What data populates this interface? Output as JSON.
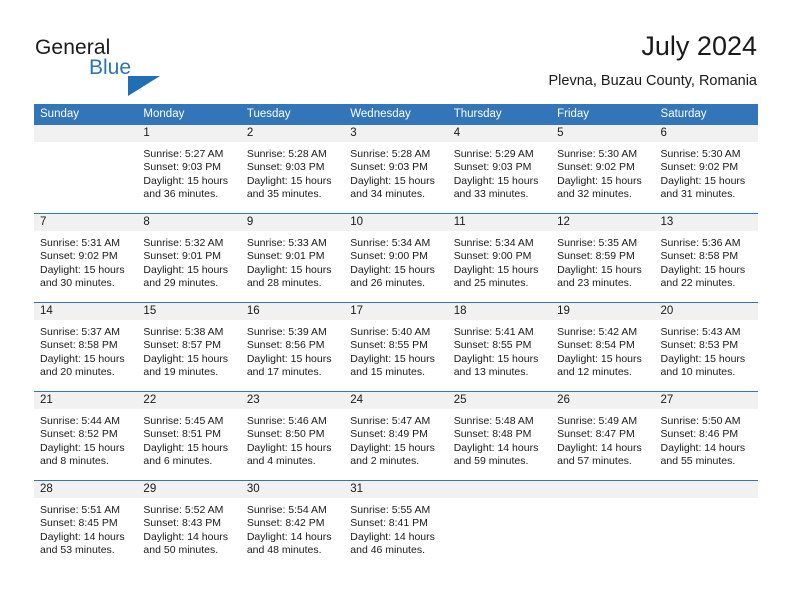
{
  "logo": {
    "word_one": "General",
    "word_two": "Blue",
    "triangle_icon": "triangle-icon",
    "brand_color": "#2a74b8"
  },
  "header": {
    "title": "July 2024",
    "subtitle": "Plevna, Buzau County, Romania"
  },
  "theme": {
    "header_blue": "#3275b8",
    "band_gray": "#f1f1f1",
    "text": "#1a1a1a"
  },
  "calendar": {
    "weekday_headers": [
      "Sunday",
      "Monday",
      "Tuesday",
      "Wednesday",
      "Thursday",
      "Friday",
      "Saturday"
    ],
    "weeks": [
      [
        {
          "day": "",
          "lines": []
        },
        {
          "day": "1",
          "lines": [
            "Sunrise: 5:27 AM",
            "Sunset: 9:03 PM",
            "Daylight: 15 hours",
            "and 36 minutes."
          ]
        },
        {
          "day": "2",
          "lines": [
            "Sunrise: 5:28 AM",
            "Sunset: 9:03 PM",
            "Daylight: 15 hours",
            "and 35 minutes."
          ]
        },
        {
          "day": "3",
          "lines": [
            "Sunrise: 5:28 AM",
            "Sunset: 9:03 PM",
            "Daylight: 15 hours",
            "and 34 minutes."
          ]
        },
        {
          "day": "4",
          "lines": [
            "Sunrise: 5:29 AM",
            "Sunset: 9:03 PM",
            "Daylight: 15 hours",
            "and 33 minutes."
          ]
        },
        {
          "day": "5",
          "lines": [
            "Sunrise: 5:30 AM",
            "Sunset: 9:02 PM",
            "Daylight: 15 hours",
            "and 32 minutes."
          ]
        },
        {
          "day": "6",
          "lines": [
            "Sunrise: 5:30 AM",
            "Sunset: 9:02 PM",
            "Daylight: 15 hours",
            "and 31 minutes."
          ]
        }
      ],
      [
        {
          "day": "7",
          "lines": [
            "Sunrise: 5:31 AM",
            "Sunset: 9:02 PM",
            "Daylight: 15 hours",
            "and 30 minutes."
          ]
        },
        {
          "day": "8",
          "lines": [
            "Sunrise: 5:32 AM",
            "Sunset: 9:01 PM",
            "Daylight: 15 hours",
            "and 29 minutes."
          ]
        },
        {
          "day": "9",
          "lines": [
            "Sunrise: 5:33 AM",
            "Sunset: 9:01 PM",
            "Daylight: 15 hours",
            "and 28 minutes."
          ]
        },
        {
          "day": "10",
          "lines": [
            "Sunrise: 5:34 AM",
            "Sunset: 9:00 PM",
            "Daylight: 15 hours",
            "and 26 minutes."
          ]
        },
        {
          "day": "11",
          "lines": [
            "Sunrise: 5:34 AM",
            "Sunset: 9:00 PM",
            "Daylight: 15 hours",
            "and 25 minutes."
          ]
        },
        {
          "day": "12",
          "lines": [
            "Sunrise: 5:35 AM",
            "Sunset: 8:59 PM",
            "Daylight: 15 hours",
            "and 23 minutes."
          ]
        },
        {
          "day": "13",
          "lines": [
            "Sunrise: 5:36 AM",
            "Sunset: 8:58 PM",
            "Daylight: 15 hours",
            "and 22 minutes."
          ]
        }
      ],
      [
        {
          "day": "14",
          "lines": [
            "Sunrise: 5:37 AM",
            "Sunset: 8:58 PM",
            "Daylight: 15 hours",
            "and 20 minutes."
          ]
        },
        {
          "day": "15",
          "lines": [
            "Sunrise: 5:38 AM",
            "Sunset: 8:57 PM",
            "Daylight: 15 hours",
            "and 19 minutes."
          ]
        },
        {
          "day": "16",
          "lines": [
            "Sunrise: 5:39 AM",
            "Sunset: 8:56 PM",
            "Daylight: 15 hours",
            "and 17 minutes."
          ]
        },
        {
          "day": "17",
          "lines": [
            "Sunrise: 5:40 AM",
            "Sunset: 8:55 PM",
            "Daylight: 15 hours",
            "and 15 minutes."
          ]
        },
        {
          "day": "18",
          "lines": [
            "Sunrise: 5:41 AM",
            "Sunset: 8:55 PM",
            "Daylight: 15 hours",
            "and 13 minutes."
          ]
        },
        {
          "day": "19",
          "lines": [
            "Sunrise: 5:42 AM",
            "Sunset: 8:54 PM",
            "Daylight: 15 hours",
            "and 12 minutes."
          ]
        },
        {
          "day": "20",
          "lines": [
            "Sunrise: 5:43 AM",
            "Sunset: 8:53 PM",
            "Daylight: 15 hours",
            "and 10 minutes."
          ]
        }
      ],
      [
        {
          "day": "21",
          "lines": [
            "Sunrise: 5:44 AM",
            "Sunset: 8:52 PM",
            "Daylight: 15 hours",
            "and 8 minutes."
          ]
        },
        {
          "day": "22",
          "lines": [
            "Sunrise: 5:45 AM",
            "Sunset: 8:51 PM",
            "Daylight: 15 hours",
            "and 6 minutes."
          ]
        },
        {
          "day": "23",
          "lines": [
            "Sunrise: 5:46 AM",
            "Sunset: 8:50 PM",
            "Daylight: 15 hours",
            "and 4 minutes."
          ]
        },
        {
          "day": "24",
          "lines": [
            "Sunrise: 5:47 AM",
            "Sunset: 8:49 PM",
            "Daylight: 15 hours",
            "and 2 minutes."
          ]
        },
        {
          "day": "25",
          "lines": [
            "Sunrise: 5:48 AM",
            "Sunset: 8:48 PM",
            "Daylight: 14 hours",
            "and 59 minutes."
          ]
        },
        {
          "day": "26",
          "lines": [
            "Sunrise: 5:49 AM",
            "Sunset: 8:47 PM",
            "Daylight: 14 hours",
            "and 57 minutes."
          ]
        },
        {
          "day": "27",
          "lines": [
            "Sunrise: 5:50 AM",
            "Sunset: 8:46 PM",
            "Daylight: 14 hours",
            "and 55 minutes."
          ]
        }
      ],
      [
        {
          "day": "28",
          "lines": [
            "Sunrise: 5:51 AM",
            "Sunset: 8:45 PM",
            "Daylight: 14 hours",
            "and 53 minutes."
          ]
        },
        {
          "day": "29",
          "lines": [
            "Sunrise: 5:52 AM",
            "Sunset: 8:43 PM",
            "Daylight: 14 hours",
            "and 50 minutes."
          ]
        },
        {
          "day": "30",
          "lines": [
            "Sunrise: 5:54 AM",
            "Sunset: 8:42 PM",
            "Daylight: 14 hours",
            "and 48 minutes."
          ]
        },
        {
          "day": "31",
          "lines": [
            "Sunrise: 5:55 AM",
            "Sunset: 8:41 PM",
            "Daylight: 14 hours",
            "and 46 minutes."
          ]
        },
        {
          "day": "",
          "lines": []
        },
        {
          "day": "",
          "lines": []
        },
        {
          "day": "",
          "lines": []
        }
      ]
    ]
  }
}
